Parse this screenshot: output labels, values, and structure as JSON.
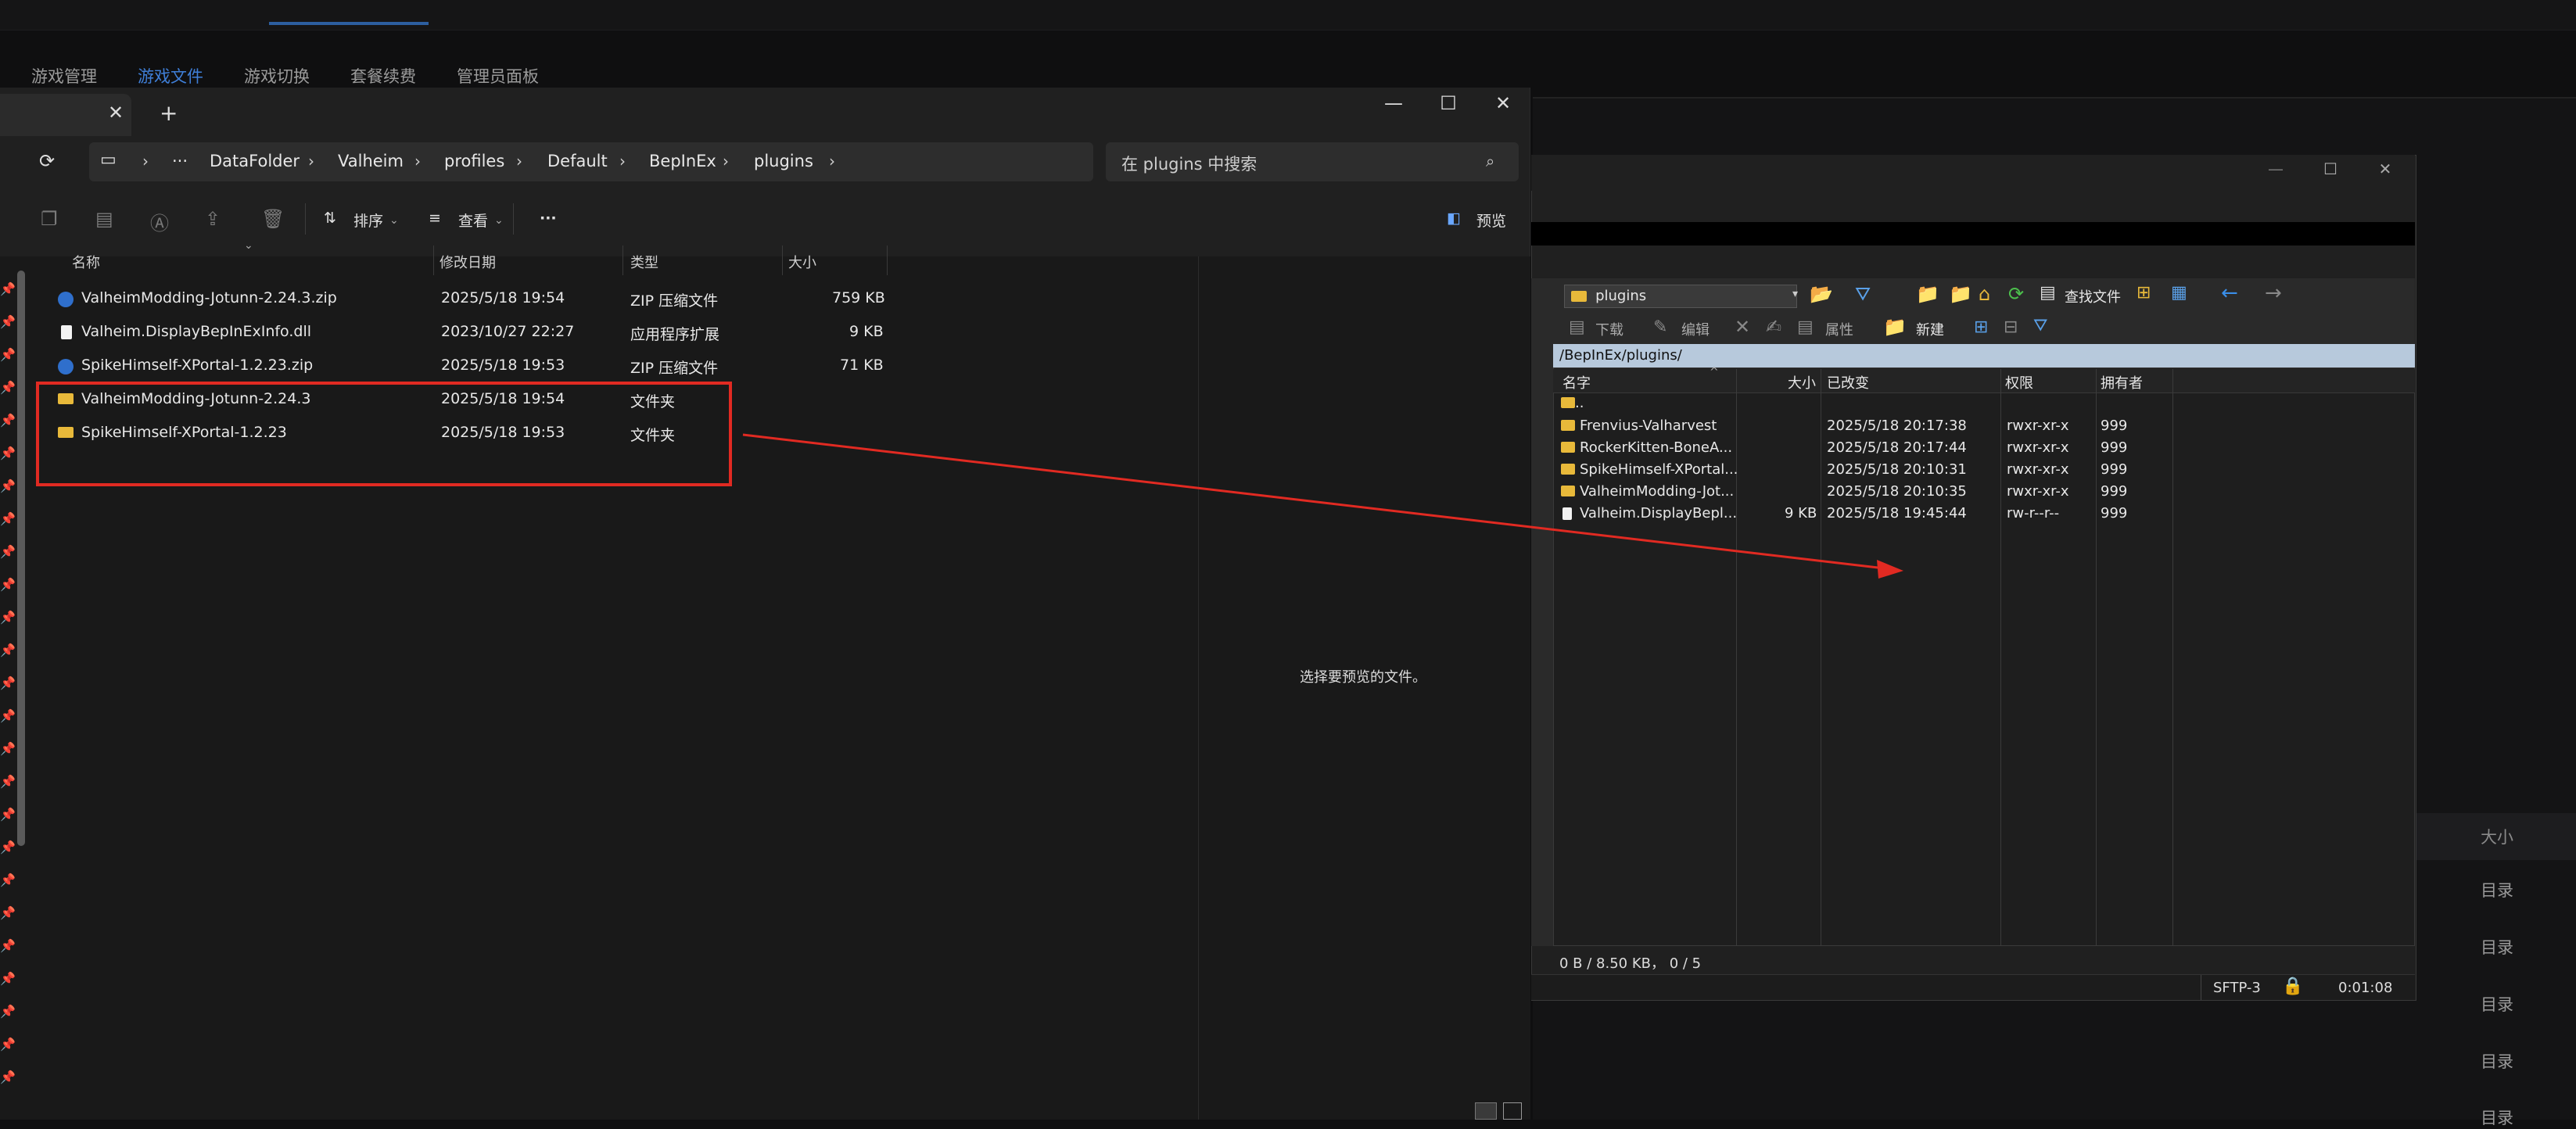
{
  "background_app": {
    "tabs": [
      "游戏管理",
      "游戏文件",
      "游戏切换",
      "套餐续费",
      "管理员面板"
    ],
    "active_tab": "游戏文件",
    "table_header_size": "大小",
    "dir_rows": [
      "目录",
      "目录",
      "目录",
      "目录",
      "目录"
    ]
  },
  "explorer": {
    "tab_close_icon": "close-icon",
    "new_tab_icon": "plus-icon",
    "window_buttons": [
      "—",
      "☐",
      "✕"
    ],
    "breadcrumb": [
      "DataFolder",
      "Valheim",
      "profiles",
      "Default",
      "BepInEx",
      "plugins"
    ],
    "breadcrumb_more": "···",
    "search_placeholder": "在 plugins 中搜索",
    "toolbar": {
      "sort": "排序",
      "view": "查看",
      "more": "···",
      "preview": "预览"
    },
    "columns": [
      "名称",
      "修改日期",
      "类型",
      "大小"
    ],
    "files": [
      {
        "name": "ValheimModding-Jotunn-2.24.3.zip",
        "date": "2025/5/18 19:54",
        "type": "ZIP 压缩文件",
        "size": "759 KB",
        "icon": "zip-icon"
      },
      {
        "name": "Valheim.DisplayBepInExInfo.dll",
        "date": "2023/10/27 22:27",
        "type": "应用程序扩展",
        "size": "9 KB",
        "icon": "file-icon"
      },
      {
        "name": "SpikeHimself-XPortal-1.2.23.zip",
        "date": "2025/5/18 19:53",
        "type": "ZIP 压缩文件",
        "size": "71 KB",
        "icon": "zip-icon"
      },
      {
        "name": "ValheimModding-Jotunn-2.24.3",
        "date": "2025/5/18 19:54",
        "type": "文件夹",
        "size": "",
        "icon": "folder-icon"
      },
      {
        "name": "SpikeHimself-XPortal-1.2.23",
        "date": "2025/5/18 19:53",
        "type": "文件夹",
        "size": "",
        "icon": "folder-icon"
      }
    ],
    "preview_text": "选择要预览的文件。"
  },
  "winscp": {
    "window_buttons": [
      "—",
      "☐",
      "✕"
    ],
    "dir_combo": "plugins",
    "toolbar": {
      "find": "查找文件",
      "download": "下载",
      "edit": "编辑",
      "properties": "属性",
      "new": "新建"
    },
    "path": "/BepInEx/plugins/",
    "columns": [
      "名字",
      "大小",
      "已改变",
      "权限",
      "拥有者"
    ],
    "rows": [
      {
        "name": "..",
        "size": "",
        "changed": "",
        "perm": "",
        "owner": "",
        "icon": "parent-folder-icon"
      },
      {
        "name": "Frenvius-Valharvest",
        "size": "",
        "changed": "2025/5/18 20:17:38",
        "perm": "rwxr-xr-x",
        "owner": "999",
        "icon": "folder-icon"
      },
      {
        "name": "RockerKitten-BoneA...",
        "size": "",
        "changed": "2025/5/18 20:17:44",
        "perm": "rwxr-xr-x",
        "owner": "999",
        "icon": "folder-icon"
      },
      {
        "name": "SpikeHimself-XPortal...",
        "size": "",
        "changed": "2025/5/18 20:10:31",
        "perm": "rwxr-xr-x",
        "owner": "999",
        "icon": "folder-icon"
      },
      {
        "name": "ValheimModding-Jot...",
        "size": "",
        "changed": "2025/5/18 20:10:35",
        "perm": "rwxr-xr-x",
        "owner": "999",
        "icon": "folder-icon"
      },
      {
        "name": "Valheim.DisplayBepl...",
        "size": "9 KB",
        "changed": "2025/5/18 19:45:44",
        "perm": "rw-r--r--",
        "owner": "999",
        "icon": "file-icon"
      }
    ],
    "status": "0 B / 8.50 KB，  0 / 5",
    "protocol": "SFTP-3",
    "elapsed": "0:01:08"
  },
  "colors": {
    "highlight": "#e12a22",
    "accent": "#3f7fd8",
    "winscp_path_bg": "#b7c9dc"
  }
}
